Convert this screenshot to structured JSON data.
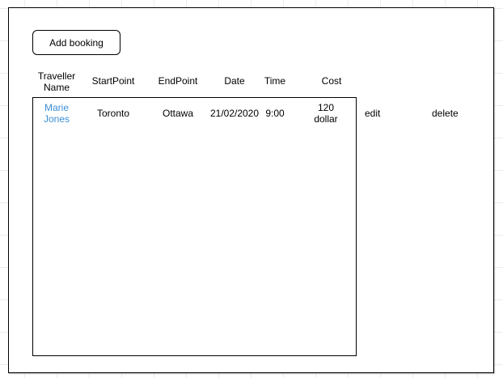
{
  "toolbar": {
    "add_booking_label": "Add booking"
  },
  "table": {
    "headers": {
      "traveller_name_line1": "Traveller",
      "traveller_name_line2": "Name",
      "start_point": "StartPoint",
      "end_point": "EndPoint",
      "date": "Date",
      "time": "Time",
      "cost": "Cost"
    },
    "rows": [
      {
        "traveller_first": "Marie",
        "traveller_last": "Jones",
        "start_point": "Toronto",
        "end_point": "Ottawa",
        "date": "21/02/2020",
        "time": "9:00",
        "cost_amount": "120",
        "cost_unit": "dollar",
        "edit_label": "edit",
        "delete_label": "delete"
      }
    ]
  },
  "colors": {
    "link": "#3c8fd6",
    "border": "#000000",
    "grid": "#ececec"
  }
}
